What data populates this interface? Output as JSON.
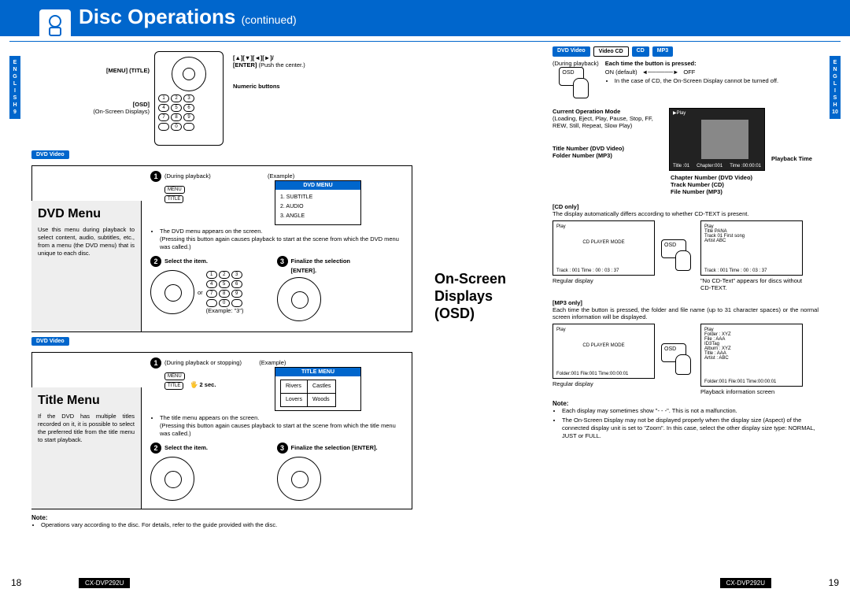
{
  "header": {
    "title": "Disc Operations",
    "continued": "(continued)"
  },
  "side": {
    "lang": "ENGLISH",
    "page_left": "9",
    "page_right": "10"
  },
  "footer": {
    "model": "CX-DVP292U",
    "pg_left": "18",
    "pg_right": "19"
  },
  "media_tags": {
    "dvd": "DVD Video",
    "vcd": "Video CD",
    "cd": "CD",
    "mp3": "MP3"
  },
  "remote": {
    "menu_title": "[MENU] (TITLE)",
    "osd": "[OSD]",
    "osd_sub": "(On-Screen Displays)",
    "nav_glyph": "[▲][▼][◄][►]/",
    "enter": "[ENTER]",
    "enter_sub": "(Push the center.)",
    "numeric": "Numeric buttons"
  },
  "dvd_menu": {
    "title": "DVD Menu",
    "desc": "Use this menu during playback to select content, audio, subtitles, etc., from a menu (the DVD menu) that is unique to each disc.",
    "step1": "(During playback)",
    "example_label": "(Example)",
    "example_hdr": "DVD MENU",
    "example_items": "1. SUBTITLE\n2. AUDIO\n3. ANGLE",
    "bullet1": "The DVD menu appears on the screen.",
    "bullet1_sub": "(Pressing this button again causes playback to start at the scene from which the DVD menu was called.)",
    "step2": "Select the item.",
    "step3": "Finalize the selection",
    "step3_sub": "[ENTER].",
    "or": "or",
    "example3": "(Example: \"3\")"
  },
  "title_menu": {
    "title": "Title Menu",
    "desc": "If the DVD has multiple titles recorded on it, it is possible to select the preferred title from the title menu to start playback.",
    "step1": "(During playback or stopping)",
    "example_label": "(Example)",
    "example_hdr": "TITLE MENU",
    "cells": [
      "Rivers",
      "Castles",
      "Lovers",
      "Woods"
    ],
    "hold": "2 sec.",
    "bullet1": "The title menu appears on the screen.",
    "bullet1_sub": "(Pressing this button again causes playback to start at the scene from which the title menu was called.)",
    "step2": "Select the item.",
    "step3": "Finalize the selection [ENTER]."
  },
  "left_note": {
    "label": "Note:",
    "text": "Operations vary according to the disc. For details, refer to the guide provided with the disc."
  },
  "osd": {
    "title": "On-Screen Displays (OSD)",
    "during": "(During playback)",
    "each_press": "Each time the button is pressed:",
    "on": "ON (default)",
    "off": "OFF",
    "cd_note": "In the case of CD, the On-Screen Display cannot be turned off.",
    "curr_mode": "Current Operation Mode",
    "curr_mode_sub": "(Loading, Eject, Play, Pause, Stop, FF, REW, Still, Repeat, Slow Play)",
    "title_num": "Title Number (DVD Video)",
    "folder_num": "Folder Number (MP3)",
    "play_time": "Playback Time",
    "chapter_num": "Chapter Number (DVD Video)",
    "track_num": "Track Number (CD)",
    "file_num": "File Number (MP3)",
    "dvd_top": "▶Play",
    "dvd_bl": "Title :01",
    "dvd_bc": "Chapter:001",
    "dvd_br": "Time :00:00:01",
    "cd_only": "[CD only]",
    "cd_text": "The display automatically differs according to whether CD-TEXT is present.",
    "regular": "Regular display",
    "no_cdtext": "\"No CD-Text\" appears for discs without CD-TEXT.",
    "cd_box1_l1": "Play",
    "cd_box1_l2": "CD PLAYER MODE",
    "cd_box1_l3": "Track : 001    Time : 00 : 03 : 37",
    "cd_box2_a": "Title      PANA",
    "cd_box2_b": "Track  01   First song",
    "cd_box2_c": "Artist    ABC",
    "cd_box2_d": "Track : 001    Time : 00 : 03 : 37",
    "mp3_only": "[MP3 only]",
    "mp3_text": "Each time the button is pressed, the folder and file name (up to 31 character spaces) or the normal screen information will be displayed.",
    "mp3_box1_l3": "Folder:001  File:001  Time:00:00:01",
    "mp3_box2_a": "Folder : XYZ",
    "mp3_box2_b": "File     : AAA",
    "mp3_box2_c": "ID3Tag",
    "mp3_box2_d": "Album : XYZ",
    "mp3_box2_e": "Title    : AAA",
    "mp3_box2_f": "Artist  : ABC",
    "mp3_box2_g": "Folder:001  File:001  Time:00:00:01",
    "playback_info": "Playback information screen",
    "note_label": "Note:",
    "note1": "Each display may sometimes show \"- - -\". This is not a malfunction.",
    "note2": "The On-Screen Display may not be displayed properly when the display size (Aspect) of the connected display unit is set to \"Zoom\". In this case, select the other display size type: NORMAL, JUST or FULL."
  }
}
